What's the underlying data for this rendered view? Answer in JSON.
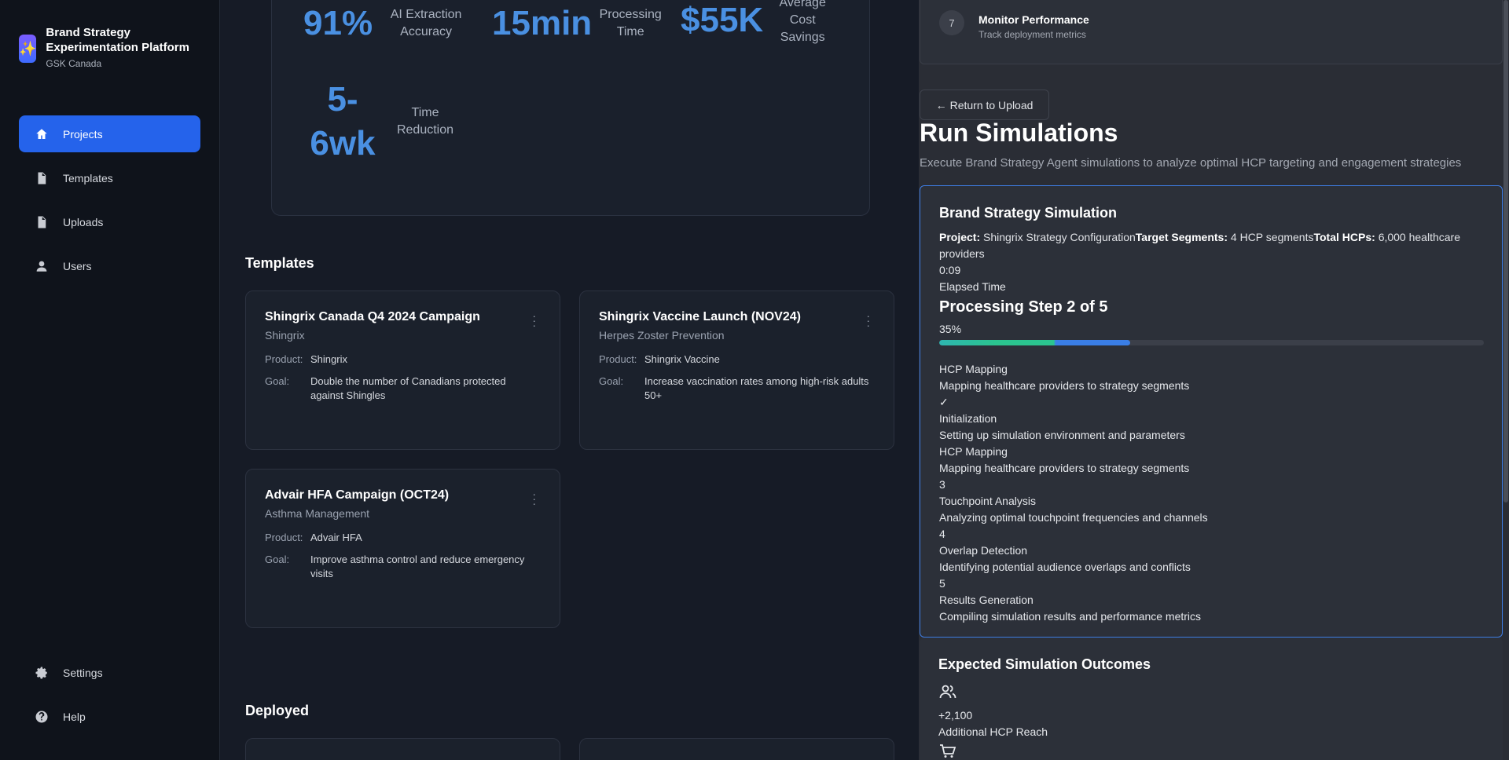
{
  "brand": {
    "title": "Brand Strategy Experimentation Platform",
    "subtitle": "GSK Canada",
    "logo_icon": "sparkles-icon"
  },
  "sidebar": {
    "items": [
      {
        "label": "Projects",
        "icon": "home-icon",
        "active": true
      },
      {
        "label": "Templates",
        "icon": "document-icon"
      },
      {
        "label": "Uploads",
        "icon": "file-icon"
      },
      {
        "label": "Users",
        "icon": "user-icon"
      }
    ],
    "bottom": [
      {
        "label": "Settings",
        "icon": "gear-icon"
      },
      {
        "label": "Help",
        "icon": "help-icon"
      }
    ]
  },
  "metrics": [
    {
      "value": "91%",
      "label": "AI Extraction Accuracy"
    },
    {
      "value": "15min",
      "label": "Processing Time"
    },
    {
      "value": "$55K",
      "label": "Average Cost Savings"
    },
    {
      "value": "5-6wk",
      "label": "Time Reduction"
    }
  ],
  "templates": {
    "title": "Templates",
    "cards": [
      {
        "title": "Shingrix Canada Q4 2024 Campaign",
        "subtitle": "Shingrix",
        "product_key": "Product:",
        "product": "Shingrix",
        "goal_key": "Goal:",
        "goal": "Double the number of Canadians protected against Shingles"
      },
      {
        "title": "Shingrix Vaccine Launch (NOV24)",
        "subtitle": "Herpes Zoster Prevention",
        "product_key": "Product:",
        "product": "Shingrix Vaccine",
        "goal_key": "Goal:",
        "goal": "Increase vaccination rates among high-risk adults 50+"
      },
      {
        "title": "Advair HFA Campaign (OCT24)",
        "subtitle": "Asthma Management",
        "product_key": "Product:",
        "product": "Advair HFA",
        "goal_key": "Goal:",
        "goal": "Improve asthma control and reduce emergency visits"
      }
    ]
  },
  "deployed": {
    "title": "Deployed"
  },
  "right": {
    "step": {
      "number": "7",
      "title": "Monitor Performance",
      "subtitle": "Track deployment metrics"
    },
    "return_label": "Return to Upload",
    "title": "Run Simulations",
    "subtitle": "Execute Brand Strategy Agent simulations to analyze optimal HCP targeting and engagement strategies",
    "simulation": {
      "title": "Brand Strategy Simulation",
      "project_key": "Project:",
      "project": "Shingrix Strategy Configuration",
      "segments_key": "Target Segments:",
      "segments": "4 HCP segments",
      "hcps_key": "Total HCPs:",
      "hcps": "6,000 healthcare providers",
      "elapsed": "0:09",
      "elapsed_label": "Elapsed Time",
      "processing": "Processing Step 2 of 5",
      "progress_label": "35%",
      "progress": 0.35,
      "current_step": {
        "name": "HCP Mapping",
        "desc": "Mapping healthcare providers to strategy segments"
      },
      "check": "✓",
      "steps": [
        {
          "marker": "",
          "name": "Initialization",
          "desc": "Setting up simulation environment and parameters"
        },
        {
          "marker": "",
          "name": "HCP Mapping",
          "desc": "Mapping healthcare providers to strategy segments"
        },
        {
          "marker": "3",
          "name": "Touchpoint Analysis",
          "desc": "Analyzing optimal touchpoint frequencies and channels"
        },
        {
          "marker": "4",
          "name": "Overlap Detection",
          "desc": "Identifying potential audience overlaps and conflicts"
        },
        {
          "marker": "5",
          "name": "Results Generation",
          "desc": "Compiling simulation results and performance metrics"
        }
      ]
    },
    "outcomes": {
      "title": "Expected Simulation Outcomes",
      "reach_value": "+2,100",
      "reach_label": "Additional HCP Reach"
    }
  }
}
